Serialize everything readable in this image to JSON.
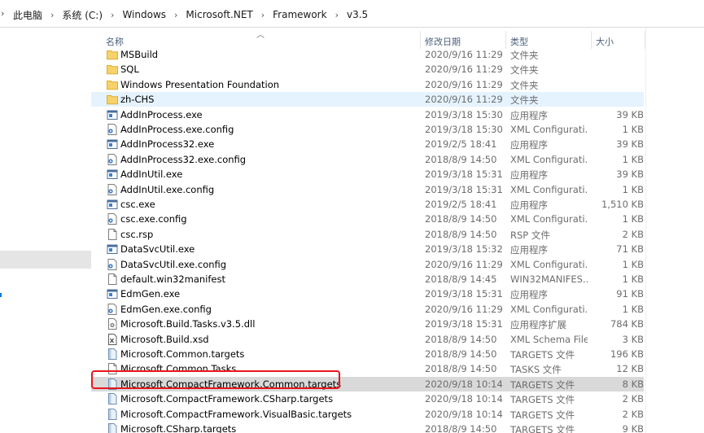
{
  "breadcrumb": [
    "此电脑",
    "系统 (C:)",
    "Windows",
    "Microsoft.NET",
    "Framework",
    "v3.5"
  ],
  "columns": {
    "name": "名称",
    "date": "修改日期",
    "type": "类型",
    "size": "大小"
  },
  "rows": [
    {
      "icon": "folder-icon",
      "name": "MSBuild",
      "date": "2020/9/16 11:29",
      "type": "文件夹",
      "size": ""
    },
    {
      "icon": "folder-icon",
      "name": "SQL",
      "date": "2020/9/16 11:29",
      "type": "文件夹",
      "size": ""
    },
    {
      "icon": "folder-icon",
      "name": "Windows Presentation Foundation",
      "date": "2020/9/16 11:29",
      "type": "文件夹",
      "size": ""
    },
    {
      "icon": "folder-icon",
      "name": "zh-CHS",
      "date": "2020/9/16 11:29",
      "type": "文件夹",
      "size": "",
      "state": "hover"
    },
    {
      "icon": "exe-icon",
      "name": "AddInProcess.exe",
      "date": "2019/3/18 15:30",
      "type": "应用程序",
      "size": "39 KB"
    },
    {
      "icon": "config-icon",
      "name": "AddInProcess.exe.config",
      "date": "2019/3/18 15:30",
      "type": "XML Configurati...",
      "size": "1 KB"
    },
    {
      "icon": "exe-icon",
      "name": "AddInProcess32.exe",
      "date": "2019/2/5 18:41",
      "type": "应用程序",
      "size": "39 KB"
    },
    {
      "icon": "config-icon",
      "name": "AddInProcess32.exe.config",
      "date": "2018/8/9 14:50",
      "type": "XML Configurati...",
      "size": "1 KB"
    },
    {
      "icon": "exe-icon",
      "name": "AddInUtil.exe",
      "date": "2019/3/18 15:31",
      "type": "应用程序",
      "size": "39 KB"
    },
    {
      "icon": "config-icon",
      "name": "AddInUtil.exe.config",
      "date": "2019/3/18 15:31",
      "type": "XML Configurati...",
      "size": "1 KB"
    },
    {
      "icon": "exe-icon",
      "name": "csc.exe",
      "date": "2019/2/5 18:41",
      "type": "应用程序",
      "size": "1,510 KB"
    },
    {
      "icon": "config-icon",
      "name": "csc.exe.config",
      "date": "2018/8/9 14:50",
      "type": "XML Configurati...",
      "size": "1 KB"
    },
    {
      "icon": "file-icon",
      "name": "csc.rsp",
      "date": "2018/8/9 14:50",
      "type": "RSP 文件",
      "size": "2 KB"
    },
    {
      "icon": "exe-icon",
      "name": "DataSvcUtil.exe",
      "date": "2019/3/18 15:32",
      "type": "应用程序",
      "size": "71 KB"
    },
    {
      "icon": "config-icon",
      "name": "DataSvcUtil.exe.config",
      "date": "2020/9/16 11:29",
      "type": "XML Configurati...",
      "size": "1 KB"
    },
    {
      "icon": "file-icon",
      "name": "default.win32manifest",
      "date": "2018/8/9 14:45",
      "type": "WIN32MANIFES...",
      "size": "1 KB"
    },
    {
      "icon": "exe-icon",
      "name": "EdmGen.exe",
      "date": "2019/3/18 15:31",
      "type": "应用程序",
      "size": "91 KB"
    },
    {
      "icon": "config-icon",
      "name": "EdmGen.exe.config",
      "date": "2020/9/16 11:29",
      "type": "XML Configurati...",
      "size": "1 KB"
    },
    {
      "icon": "dll-icon",
      "name": "Microsoft.Build.Tasks.v3.5.dll",
      "date": "2019/3/18 15:31",
      "type": "应用程序扩展",
      "size": "784 KB"
    },
    {
      "icon": "xsd-icon",
      "name": "Microsoft.Build.xsd",
      "date": "2018/8/9 14:50",
      "type": "XML Schema File",
      "size": "3 KB"
    },
    {
      "icon": "targets-icon",
      "name": "Microsoft.Common.targets",
      "date": "2018/8/9 14:50",
      "type": "TARGETS 文件",
      "size": "196 KB"
    },
    {
      "icon": "file-icon",
      "name": "Microsoft.Common.Tasks",
      "date": "2018/8/9 14:50",
      "type": "TASKS 文件",
      "size": "12 KB"
    },
    {
      "icon": "targets-icon",
      "name": "Microsoft.CompactFramework.Common.targets",
      "date": "2020/9/18 10:14",
      "type": "TARGETS 文件",
      "size": "8 KB",
      "state": "selected"
    },
    {
      "icon": "targets-icon",
      "name": "Microsoft.CompactFramework.CSharp.targets",
      "date": "2020/9/18 10:14",
      "type": "TARGETS 文件",
      "size": "2 KB"
    },
    {
      "icon": "targets-icon",
      "name": "Microsoft.CompactFramework.VisualBasic.targets",
      "date": "2020/9/18 10:14",
      "type": "TARGETS 文件",
      "size": "2 KB"
    },
    {
      "icon": "targets-icon",
      "name": "Microsoft.CSharp.targets",
      "date": "2018/8/9 14:50",
      "type": "TARGETS 文件",
      "size": "9 KB"
    }
  ],
  "colors": {
    "hover": "#e5f3ff",
    "selected": "#d9d9d9",
    "highlight_box": "#e8161c",
    "folder": "#f5c543"
  }
}
